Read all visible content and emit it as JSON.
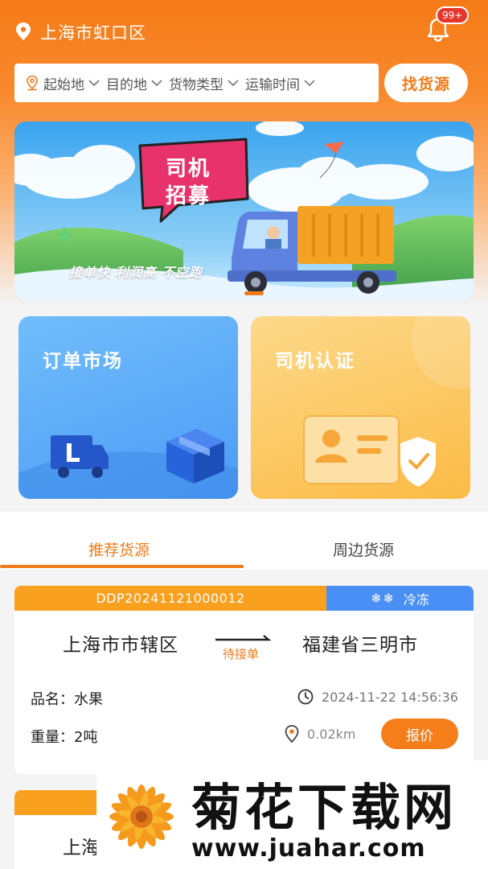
{
  "header": {
    "location": "上海市虹口区",
    "badge": "99+"
  },
  "filter": {
    "items": [
      "起始地",
      "目的地",
      "货物类型",
      "运输时间"
    ],
    "search_label": "找货源"
  },
  "banner": {
    "title_line1": "司机",
    "title_line2": "招募",
    "subtitle": "接单快  利润高  不空跑"
  },
  "cards": {
    "order_market": "订单市场",
    "driver_cert": "司机认证"
  },
  "tabs": [
    {
      "label": "推荐货源",
      "active": true
    },
    {
      "label": "周边货源",
      "active": false
    }
  ],
  "orders": [
    {
      "order_no": "DDP20241121000012",
      "cargo_type": "冷冻",
      "from": "上海市市辖区",
      "to": "福建省三明市",
      "status": "待接单",
      "name_label": "品名：水果",
      "weight_label": "重量：2吨",
      "time": "2024-11-22 14:56:36",
      "distance": "0.02km",
      "quote_label": "报价"
    },
    {
      "from": "上海"
    }
  ],
  "watermark": {
    "title": "菊花下载网",
    "url": "www.juahar.com"
  },
  "colors": {
    "accent": "#f07a19",
    "blue_tag": "#4a8ff5",
    "orange_tag": "#f9a01e"
  }
}
